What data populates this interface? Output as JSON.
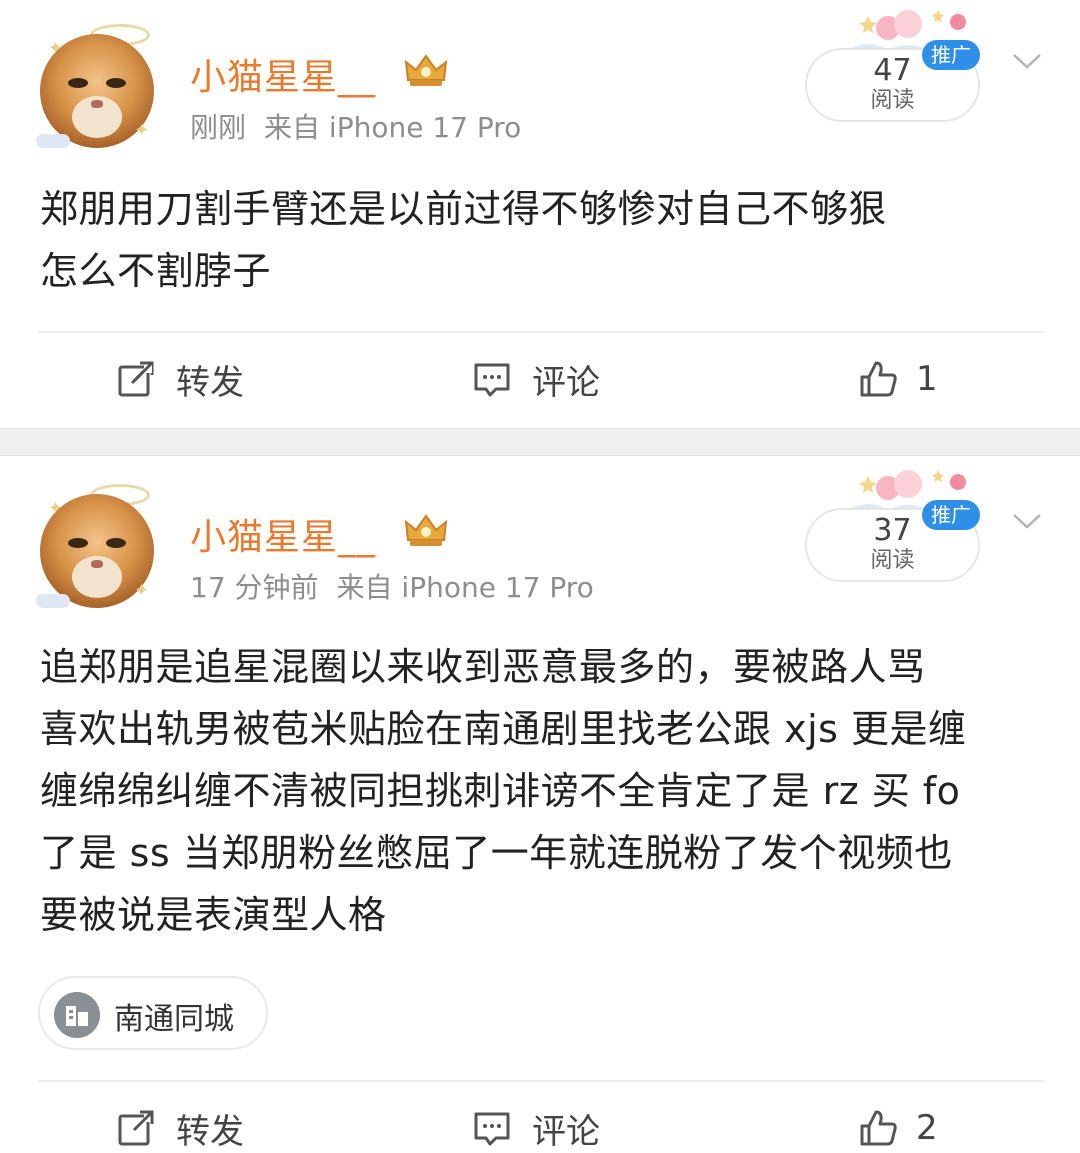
{
  "posts": [
    {
      "username": "小猫星星__",
      "time": "刚刚",
      "source": "来自 iPhone 17 Pro",
      "reads_count": "47",
      "reads_label": "阅读",
      "promo_tag": "推广",
      "content_lines": [
        "郑朋用刀割手臂还是以前过得不够惨对自己不够狠",
        "怎么不割脖子"
      ],
      "actions": {
        "repost_label": "转发",
        "comment_label": "评论",
        "like_count": "1"
      }
    },
    {
      "username": "小猫星星__",
      "time": "17 分钟前",
      "source": "来自 iPhone 17 Pro",
      "reads_count": "37",
      "reads_label": "阅读",
      "promo_tag": "推广",
      "content_lines": [
        "追郑朋是追星混圈以来收到恶意最多的，要被路人骂",
        "喜欢出轨男被苞米贴脸在南通剧里找老公跟 xjs 更是缠",
        "缠绵绵纠缠不清被同担挑刺诽谤不全肯定了是 rz 买 fo",
        "了是 ss 当郑朋粉丝憋屈了一年就连脱粉了发个视频也",
        "要被说是表演型人格"
      ],
      "location": "南通同城",
      "actions": {
        "repost_label": "转发",
        "comment_label": "评论",
        "like_count": "2"
      }
    }
  ],
  "icons": {
    "repost": "repost-icon",
    "comment": "comment-icon",
    "like": "thumbs-up-icon",
    "more": "chevron-down-icon",
    "location": "city-icon",
    "vip": "crown-badge-icon"
  },
  "colors": {
    "username": "#e8792d",
    "promo": "#2f8fe8",
    "meta": "#8e8e8e",
    "separator": "#efefef"
  }
}
